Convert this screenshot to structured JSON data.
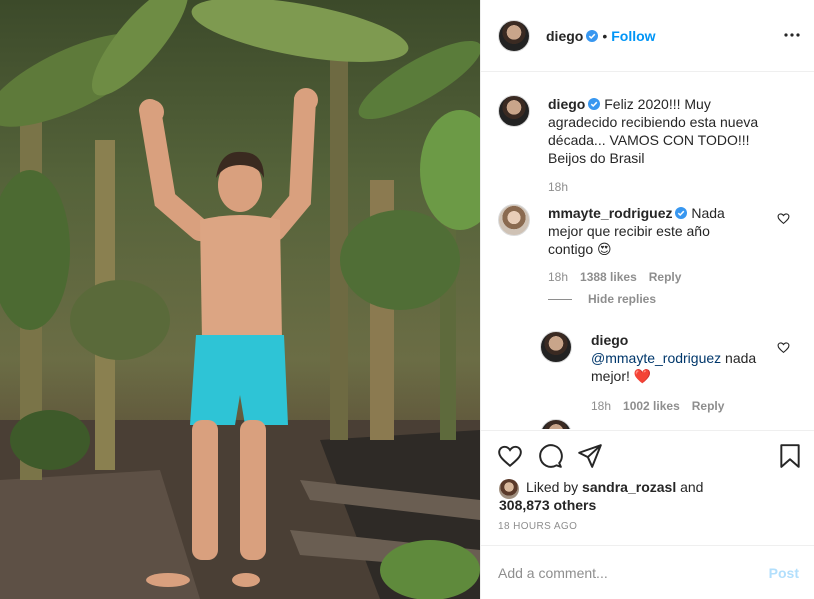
{
  "post": {
    "author": "diego",
    "follow_label": "Follow",
    "separator": "•",
    "caption_author": "diego",
    "caption": "Feliz 2020!!! Muy agradecido recibiendo esta nueva década... VAMOS CON TODO!!! Beijos do Brasil",
    "caption_lines": [
      "Feliz 2020!!! Muy",
      "agradecido recibiendo esta nueva",
      "década... VAMOS CON TODO!!!",
      "Beijos do Brasil"
    ],
    "caption_age": "18h"
  },
  "comments": [
    {
      "username": "mmayte_rodriguez",
      "lines": [
        "Nada",
        "mejor que recibir este año",
        "contigo 😍"
      ],
      "age": "18h",
      "likes": "1388 likes",
      "reply_label": "Reply",
      "hide_replies_label": "Hide replies"
    },
    {
      "username": "diego",
      "mention": "@mmayte_rodriguez",
      "text_after_mention": " nada",
      "line2": "mejor! ❤️",
      "age": "18h",
      "likes": "1002 likes",
      "reply_label": "Reply"
    }
  ],
  "likes_block": {
    "prefix": "Liked by ",
    "user": "sandra_rozasl",
    "and": " and",
    "others": "308,873 others",
    "timestamp": "18 HOURS AGO"
  },
  "add_comment": {
    "placeholder": "Add a comment...",
    "post_label": "Post"
  },
  "icons": {
    "verified": "verified-badge-icon",
    "more": "more-options-icon",
    "like": "heart-icon",
    "comment": "comment-icon",
    "share": "share-icon",
    "save": "bookmark-icon"
  },
  "colors": {
    "accent": "#0095f6",
    "post_disabled": "#b2dffc",
    "swim_trunks": "#2ec4d6",
    "heart_red": "#ed4956"
  }
}
